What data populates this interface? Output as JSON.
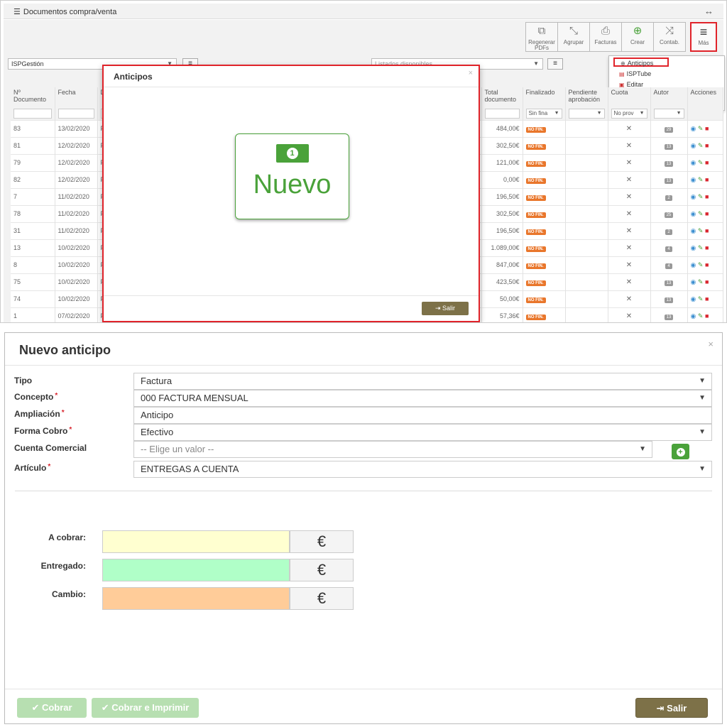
{
  "top": {
    "panel_title": "Documentos compra/venta",
    "toolbar": [
      {
        "name": "regenerar",
        "icon": "⧉",
        "label": "Regenerar PDFs"
      },
      {
        "name": "agrupar",
        "icon": "⤡",
        "label": "Agrupar"
      },
      {
        "name": "facturas",
        "icon": "⎙",
        "label": "Facturas"
      },
      {
        "name": "crear",
        "icon": "⊕",
        "label": "Crear"
      },
      {
        "name": "contab",
        "icon": "⤨",
        "label": "Contab."
      }
    ],
    "mas_label": "Más",
    "mas_icon": "≡",
    "dropdown": {
      "anticipos": "Anticipos",
      "isptube": "ISPTube",
      "editar": "Editar"
    },
    "filter_select": "ISPGestión",
    "listados_select": "Listados disponibles",
    "columns": {
      "n_doc": "Nº Documento",
      "fecha": "Fecha",
      "col_d": "D",
      "total": "Total documento",
      "finalizado": "Finalizado",
      "pendiente": "Pendiente aprobación",
      "cuota": "Cuota",
      "autor": "Autor",
      "acciones": "Acciones"
    },
    "filters": {
      "finalizado": "Sin fina",
      "cuota": "No prov"
    },
    "rows": [
      {
        "n": "83",
        "fecha": "13/02/2020",
        "d": "P",
        "total": "484,00€",
        "estado": "NO FIN.",
        "autor": "29"
      },
      {
        "n": "81",
        "fecha": "12/02/2020",
        "d": "P",
        "total": "302,50€",
        "estado": "NO FIN.",
        "autor": "13"
      },
      {
        "n": "79",
        "fecha": "12/02/2020",
        "d": "P",
        "total": "121,00€",
        "estado": "NO FIN.",
        "autor": "13"
      },
      {
        "n": "82",
        "fecha": "12/02/2020",
        "d": "P",
        "total": "0,00€",
        "estado": "NO FIN.",
        "autor": "13"
      },
      {
        "n": "7",
        "fecha": "11/02/2020",
        "d": "P",
        "total": "196,50€",
        "estado": "NO FIN.",
        "autor": "2"
      },
      {
        "n": "78",
        "fecha": "11/02/2020",
        "d": "P",
        "total": "302,50€",
        "estado": "NO FIN.",
        "autor": "25"
      },
      {
        "n": "31",
        "fecha": "11/02/2020",
        "d": "P",
        "total": "196,50€",
        "estado": "NO FIN.",
        "autor": "2"
      },
      {
        "n": "13",
        "fecha": "10/02/2020",
        "d": "P",
        "total": "1.089,00€",
        "estado": "NO FIN.",
        "autor": "4"
      },
      {
        "n": "8",
        "fecha": "10/02/2020",
        "d": "P",
        "total": "847,00€",
        "estado": "NO FIN.",
        "autor": "4"
      },
      {
        "n": "75",
        "fecha": "10/02/2020",
        "d": "P",
        "total": "423,50€",
        "estado": "NO FIN.",
        "autor": "13"
      },
      {
        "n": "74",
        "fecha": "10/02/2020",
        "d": "P",
        "total": "50,00€",
        "estado": "NO FIN.",
        "autor": "13"
      },
      {
        "n": "1",
        "fecha": "07/02/2020",
        "d": "P",
        "total": "57,36€",
        "estado": "NO FIN.",
        "autor": "13"
      }
    ],
    "cuota_mark": "✕",
    "modal": {
      "title": "Anticipos",
      "card_label": "Nuevo",
      "card_icon_text": "1",
      "salir": "Salir",
      "close": "×"
    }
  },
  "bottom": {
    "title": "Nuevo anticipo",
    "close": "×",
    "fields": {
      "tipo": {
        "label": "Tipo",
        "value": "Factura"
      },
      "concepto": {
        "label": "Concepto",
        "value": "000 FACTURA MENSUAL"
      },
      "ampliacion": {
        "label": "Ampliación",
        "value": "Anticipo"
      },
      "forma_cobro": {
        "label": "Forma Cobro",
        "value": "Efectivo"
      },
      "cuenta": {
        "label": "Cuenta Comercial",
        "placeholder": "-- Elige un valor --"
      },
      "articulo": {
        "label": "Artículo",
        "value": "ENTREGAS A CUENTA"
      }
    },
    "amounts": [
      {
        "label": "A cobrar:",
        "color": "#ffffd0",
        "currency": "€"
      },
      {
        "label": "Entregado:",
        "color": "#b0ffc8",
        "currency": "€"
      },
      {
        "label": "Cambio:",
        "color": "#ffcc99",
        "currency": "€"
      }
    ],
    "buttons": {
      "cobrar": "✔ Cobrar",
      "cobrar_imprimir": "✔ Cobrar e Imprimir",
      "salir": "Salir"
    }
  }
}
